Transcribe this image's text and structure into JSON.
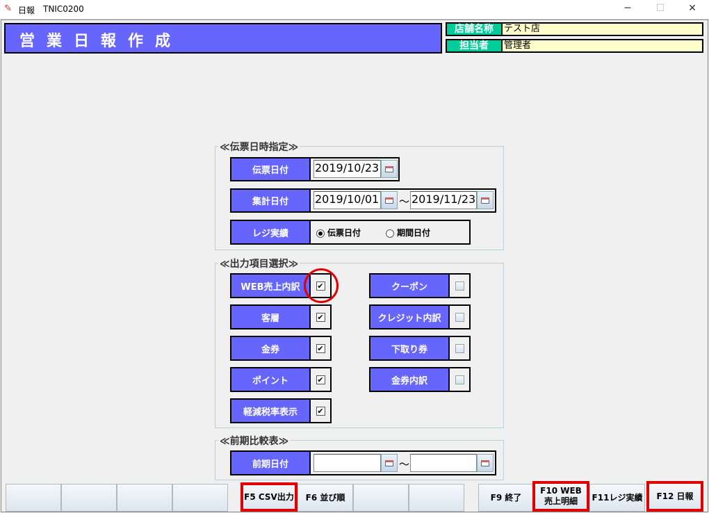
{
  "window": {
    "title": "日報",
    "code": "TNIC0200",
    "minimize": "─",
    "maximize": "☐",
    "close": "✕"
  },
  "header": {
    "title": "営業日報作成",
    "store_label": "店舗名称",
    "store_value": "テスト店",
    "staff_label": "担当者",
    "staff_value": "管理者"
  },
  "date_group": {
    "legend": "≪伝票日時指定≫",
    "slip_date_label": "伝票日付",
    "slip_date": "2019/10/23",
    "agg_date_label": "集計日付",
    "agg_from": "2019/10/01",
    "tilde": "～",
    "agg_to": "2019/11/23",
    "register_label": "レジ実績",
    "radio_options": [
      {
        "label": "伝票日付",
        "selected": true
      },
      {
        "label": "期間日付",
        "selected": false
      }
    ]
  },
  "output_group": {
    "legend": "≪出力項目選択≫",
    "left": [
      {
        "label": "WEB売上内訳",
        "checked": true
      },
      {
        "label": "客層",
        "checked": true
      },
      {
        "label": "金券",
        "checked": true
      },
      {
        "label": "ポイント",
        "checked": true
      },
      {
        "label": "軽減税率表示",
        "checked": true
      }
    ],
    "right": [
      {
        "label": "クーポン",
        "checked": false
      },
      {
        "label": "クレジット内訳",
        "checked": false
      },
      {
        "label": "下取り券",
        "checked": false
      },
      {
        "label": "金券内訳",
        "checked": false
      }
    ]
  },
  "compare_group": {
    "legend": "≪前期比較表≫",
    "label": "前期日付",
    "from": "",
    "tilde": "～",
    "to": ""
  },
  "fkeys": {
    "f5": "F5 CSV出力",
    "f6": "F6 並び順",
    "f9": "F9 終了",
    "f10": "F10 WEB\n売上明細",
    "f11": "F11レジ実績",
    "f12": "F12 日報"
  },
  "check_mark": "✔"
}
